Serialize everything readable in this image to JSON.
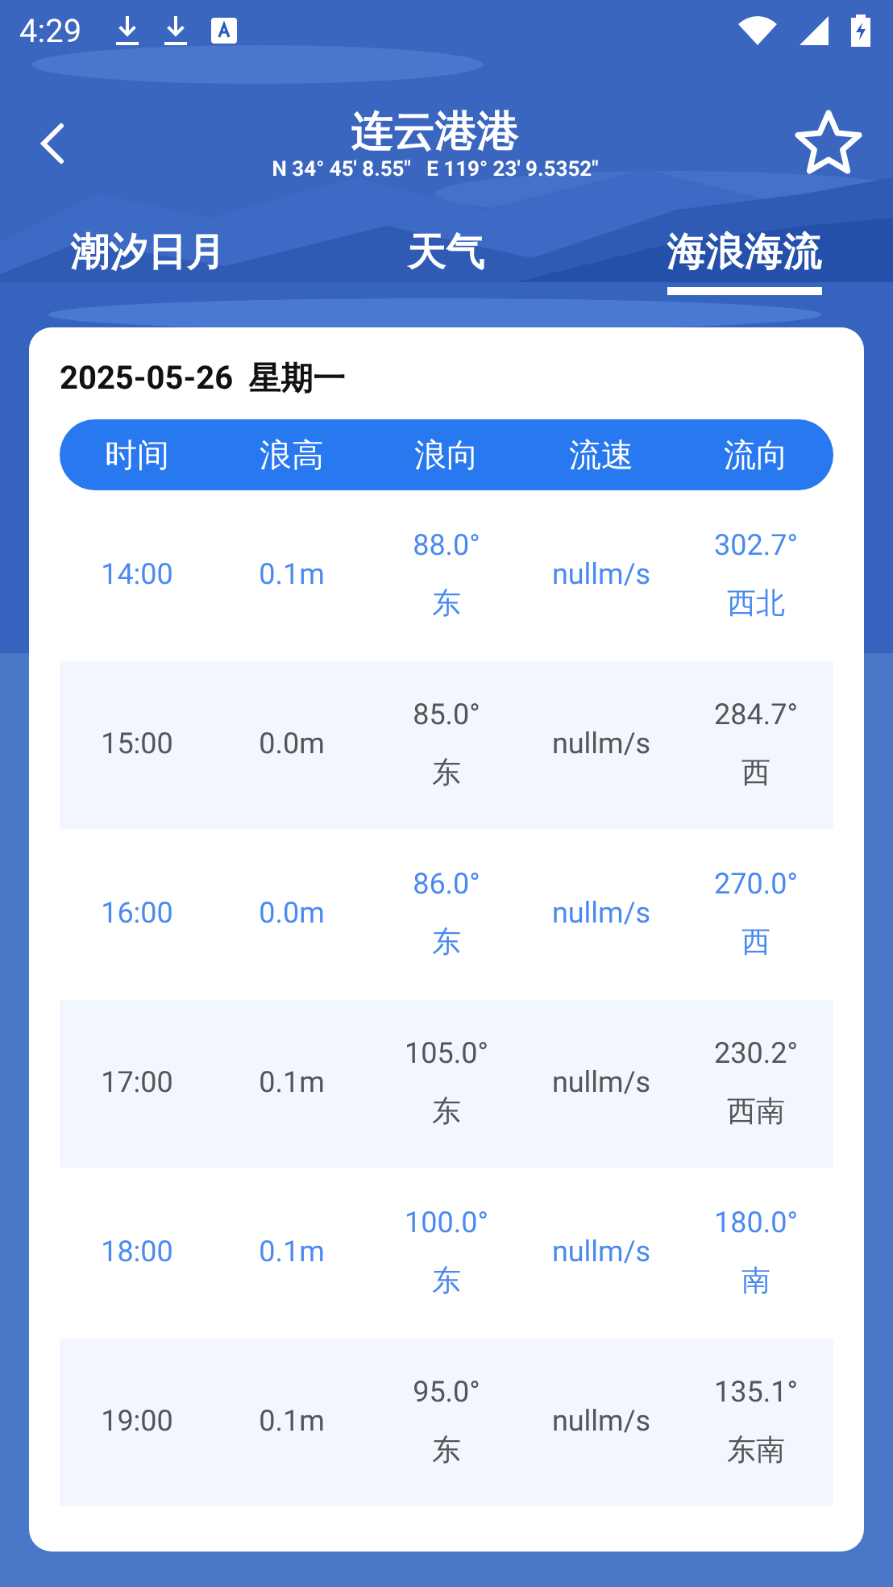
{
  "status_bar": {
    "time": "4:29"
  },
  "header": {
    "title": "连云港港",
    "coordinates": "N 34° 45' 8.55\"   E 119° 23' 9.5352\""
  },
  "tabs": [
    {
      "label": "潮汐日月",
      "selected": false
    },
    {
      "label": "天气",
      "selected": false
    },
    {
      "label": "海浪海流",
      "selected": true
    }
  ],
  "card": {
    "date": "2025-05-26  星期一",
    "columns": [
      "时间",
      "浪高",
      "浪向",
      "流速",
      "流向"
    ],
    "rows": [
      {
        "time": "14:00",
        "wave_height": "0.1m",
        "wave_direction": "88.0°",
        "wave_direction_name": "东",
        "current_speed": "nullm/s",
        "current_direction": "302.7°",
        "current_direction_name": "西北"
      },
      {
        "time": "15:00",
        "wave_height": "0.0m",
        "wave_direction": "85.0°",
        "wave_direction_name": "东",
        "current_speed": "nullm/s",
        "current_direction": "284.7°",
        "current_direction_name": "西"
      },
      {
        "time": "16:00",
        "wave_height": "0.0m",
        "wave_direction": "86.0°",
        "wave_direction_name": "东",
        "current_speed": "nullm/s",
        "current_direction": "270.0°",
        "current_direction_name": "西"
      },
      {
        "time": "17:00",
        "wave_height": "0.1m",
        "wave_direction": "105.0°",
        "wave_direction_name": "东",
        "current_speed": "nullm/s",
        "current_direction": "230.2°",
        "current_direction_name": "西南"
      },
      {
        "time": "18:00",
        "wave_height": "0.1m",
        "wave_direction": "100.0°",
        "wave_direction_name": "东",
        "current_speed": "nullm/s",
        "current_direction": "180.0°",
        "current_direction_name": "南"
      },
      {
        "time": "19:00",
        "wave_height": "0.1m",
        "wave_direction": "95.0°",
        "wave_direction_name": "东",
        "current_speed": "nullm/s",
        "current_direction": "135.1°",
        "current_direction_name": "东南"
      }
    ]
  }
}
